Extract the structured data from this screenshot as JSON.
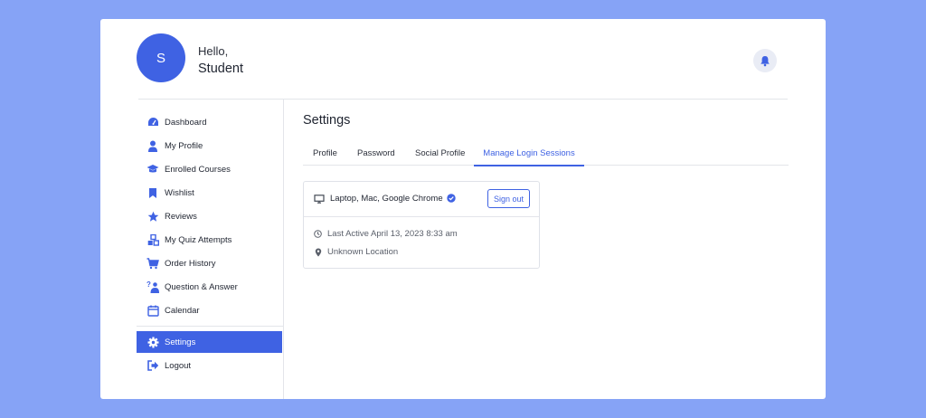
{
  "user": {
    "initial": "S",
    "greeting": "Hello,",
    "name": "Student"
  },
  "header": {
    "notifications_icon": "bell-icon"
  },
  "sidebar": {
    "items": [
      {
        "label": "Dashboard",
        "icon": "dashboard-icon"
      },
      {
        "label": "My Profile",
        "icon": "user-icon"
      },
      {
        "label": "Enrolled Courses",
        "icon": "graduation-cap-icon"
      },
      {
        "label": "Wishlist",
        "icon": "bookmark-icon"
      },
      {
        "label": "Reviews",
        "icon": "star-icon"
      },
      {
        "label": "My Quiz Attempts",
        "icon": "quiz-blocks-icon"
      },
      {
        "label": "Order History",
        "icon": "cart-icon"
      },
      {
        "label": "Question & Answer",
        "icon": "question-person-icon"
      },
      {
        "label": "Calendar",
        "icon": "calendar-icon"
      },
      {
        "label": "Settings",
        "icon": "gear-icon",
        "active": true
      },
      {
        "label": "Logout",
        "icon": "logout-icon"
      }
    ]
  },
  "main": {
    "title": "Settings",
    "tabs": [
      {
        "label": "Profile"
      },
      {
        "label": "Password"
      },
      {
        "label": "Social Profile"
      },
      {
        "label": "Manage Login Sessions",
        "active": true
      }
    ],
    "session": {
      "device": "Laptop, Mac, Google Chrome",
      "sign_out_label": "Sign out",
      "last_active": "Last Active April 13, 2023 8:33 am",
      "location": "Unknown Location"
    }
  },
  "colors": {
    "accent": "#3f62e3",
    "background": "#86a3f6",
    "card": "#ffffff"
  }
}
